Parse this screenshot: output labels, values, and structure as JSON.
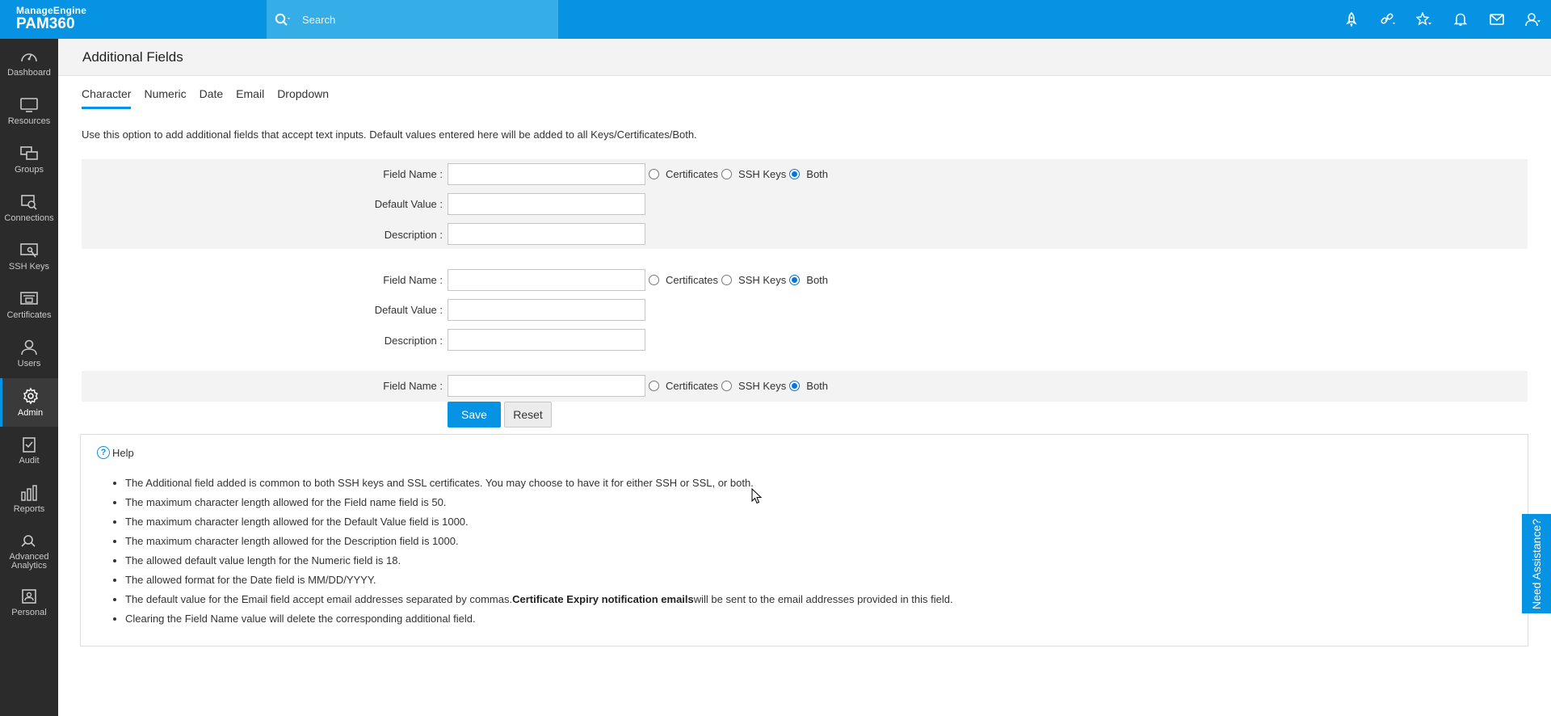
{
  "brand": {
    "company": "ManageEngine",
    "product": "PAM360"
  },
  "search": {
    "placeholder": "Search"
  },
  "top_icons": [
    "rocket-icon",
    "link-settings-icon",
    "star-icon",
    "bell-icon",
    "mail-icon",
    "user-icon"
  ],
  "sidebar": {
    "items": [
      {
        "label": "Dashboard",
        "icon": "dashboard-icon"
      },
      {
        "label": "Resources",
        "icon": "monitor-icon"
      },
      {
        "label": "Groups",
        "icon": "groups-icon"
      },
      {
        "label": "Connections",
        "icon": "connections-icon"
      },
      {
        "label": "SSH Keys",
        "icon": "ssh-keys-icon"
      },
      {
        "label": "Certificates",
        "icon": "certificates-icon"
      },
      {
        "label": "Users",
        "icon": "users-icon"
      },
      {
        "label": "Admin",
        "icon": "gear-icon",
        "active": true
      },
      {
        "label": "Audit",
        "icon": "audit-icon"
      },
      {
        "label": "Reports",
        "icon": "reports-icon"
      },
      {
        "label": "Advanced Analytics",
        "icon": "analytics-icon"
      },
      {
        "label": "Personal",
        "icon": "personal-icon"
      }
    ]
  },
  "page": {
    "title": "Additional Fields"
  },
  "tabs": [
    {
      "label": "Character",
      "active": true
    },
    {
      "label": "Numeric"
    },
    {
      "label": "Date"
    },
    {
      "label": "Email"
    },
    {
      "label": "Dropdown"
    }
  ],
  "description": "Use this option to add additional fields that accept text inputs. Default values entered here will be added to all Keys/Certificates/Both.",
  "form": {
    "field_name_label": "Field Name :",
    "default_value_label": "Default Value :",
    "description_label": "Description :",
    "radio_certificates": "Certificates",
    "radio_ssh_keys": "SSH Keys",
    "radio_both": "Both",
    "selected": "Both"
  },
  "buttons": {
    "save": "Save",
    "reset": "Reset"
  },
  "help": {
    "title": "Help",
    "items": [
      "The Additional field added is common to both SSH keys and SSL certificates. You may choose to have it for either SSH or SSL, or both.",
      "The maximum character length allowed for the Field name field is 50.",
      "The maximum character length allowed for the Default Value field is 1000.",
      "The maximum character length allowed for the Description field is 1000.",
      "The allowed default value length for the Numeric field is 18.",
      "The allowed format for the Date field is MM/DD/YYYY."
    ],
    "email_item_pre": "The default value for the Email field accept email addresses separated by commas.",
    "email_item_bold": "Certificate Expiry notification emails",
    "email_item_post": "will be sent to the email addresses provided in this field.",
    "last_item": "Clearing the Field Name value will delete the corresponding additional field."
  },
  "need_assistance": "Need Assistance?",
  "colors": {
    "accent": "#0693e3",
    "sidebar": "#2b2b2b"
  }
}
